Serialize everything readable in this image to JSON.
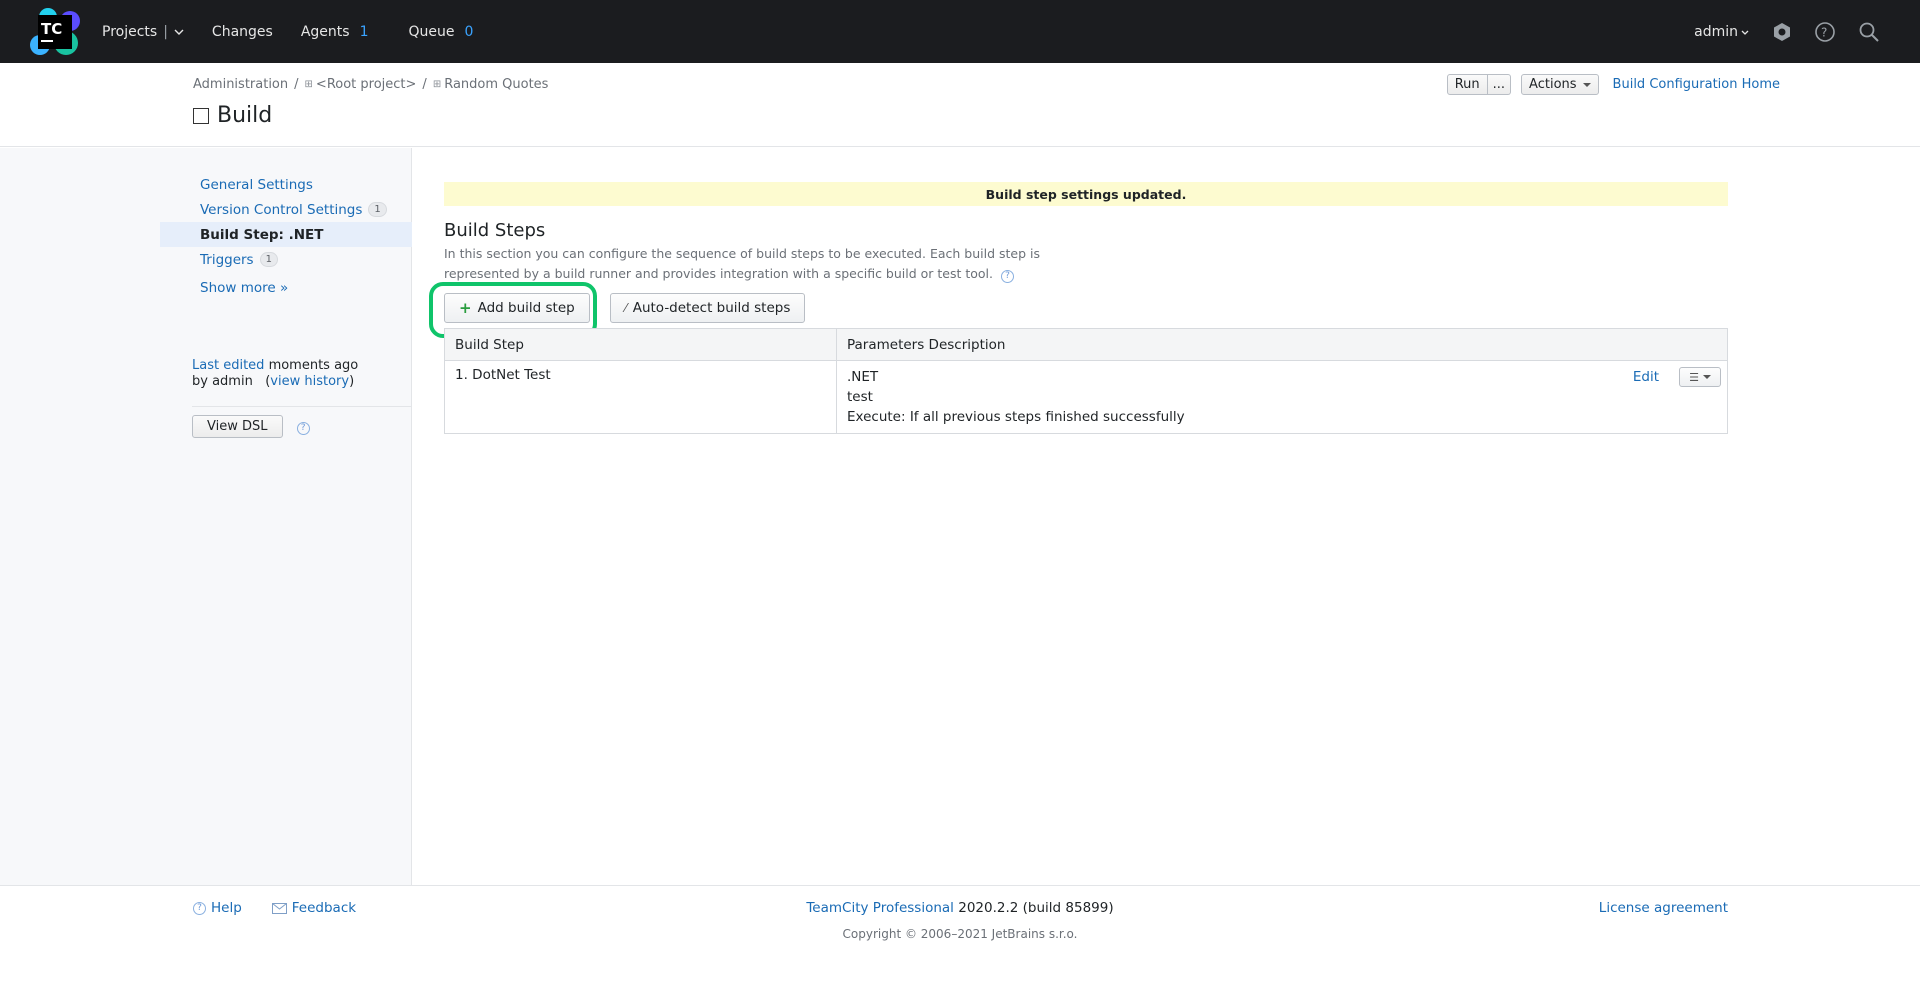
{
  "topbar": {
    "logo_text": "TC",
    "projects_label": "Projects",
    "changes_label": "Changes",
    "agents_label": "Agents",
    "agents_count": "1",
    "queue_label": "Queue",
    "queue_count": "0",
    "user_label": "admin"
  },
  "breadcrumb": {
    "admin": "Administration",
    "root": "<Root project>",
    "project": "Random Quotes"
  },
  "page": {
    "title": "Build"
  },
  "header_actions": {
    "run_label": "Run",
    "run_more_label": "...",
    "actions_label": "Actions",
    "home_link": "Build Configuration Home"
  },
  "sidebar": {
    "items": [
      {
        "label": "General Settings",
        "badge": ""
      },
      {
        "label": "Version Control Settings",
        "badge": "1"
      },
      {
        "label": "Build Step: .NET",
        "badge": ""
      },
      {
        "label": "Triggers",
        "badge": "1"
      }
    ],
    "show_more": "Show more »",
    "last_edited_link": "Last edited",
    "last_edited_time": "moments ago",
    "by_text": "by admin",
    "view_history": "view history",
    "view_dsl": "View DSL"
  },
  "main": {
    "message": "Build step settings updated.",
    "section_title": "Build Steps",
    "description": "In this section you can configure the sequence of build steps to be executed. Each build step is represented by a build runner and provides integration with a specific build or test tool.",
    "add_button": "Add build step",
    "autodetect_button": "Auto-detect build steps",
    "table": {
      "headers": [
        "Build Step",
        "Parameters Description"
      ],
      "rows": [
        {
          "step": "1. DotNet Test",
          "params": [
            ".NET",
            "test",
            "Execute: If all previous steps finished successfully"
          ],
          "edit_label": "Edit"
        }
      ]
    }
  },
  "footer": {
    "help": "Help",
    "feedback": "Feedback",
    "product_link": "TeamCity Professional",
    "version": "2020.2.2 (build 85899)",
    "copyright": "Copyright © 2006–2021 JetBrains s.r.o.",
    "license": "License agreement"
  },
  "colors": {
    "topbar_bg": "#1b1c1f",
    "link": "#1a6bb5",
    "highlight_outline": "#0fc46a",
    "message_bg": "#fdfbd0"
  }
}
